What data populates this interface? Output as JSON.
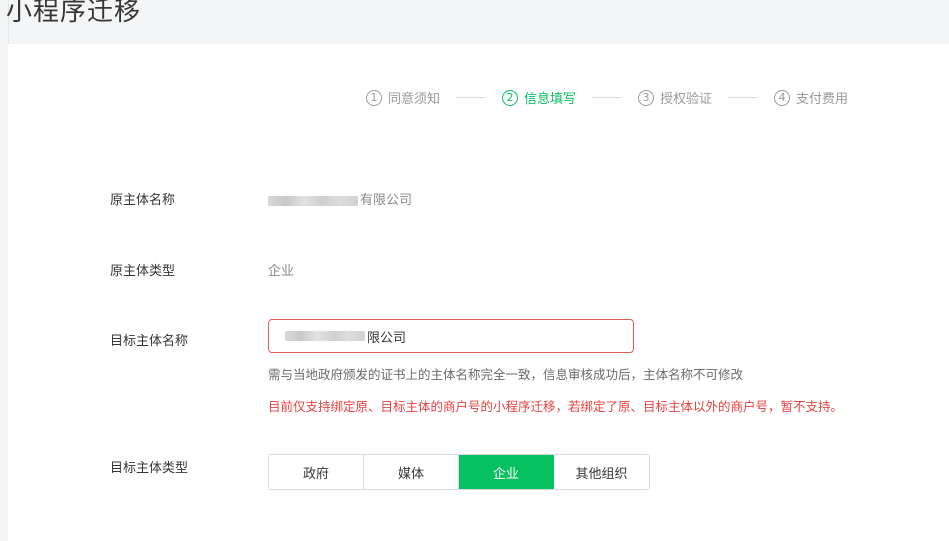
{
  "page": {
    "title": "小程序迁移"
  },
  "stepper": {
    "steps": [
      {
        "num": "1",
        "label": "同意须知"
      },
      {
        "num": "2",
        "label": "信息填写"
      },
      {
        "num": "3",
        "label": "授权验证"
      },
      {
        "num": "4",
        "label": "支付费用"
      }
    ],
    "active_index": 1,
    "accent_color": "#07c160"
  },
  "form": {
    "original_name_label": "原主体名称",
    "original_name_value_visible": "有限公司",
    "original_type_label": "原主体类型",
    "original_type_value": "企业",
    "target_name_label": "目标主体名称",
    "target_name_value_visible": "限公司",
    "target_name_hint": "需与当地政府颁发的证书上的主体名称完全一致，信息审核成功后，主体名称不可修改",
    "target_name_warning": "目前仅支持绑定原、目标主体的商户号的小程序迁移，若绑定了原、目标主体以外的商户号，暂不支持。",
    "target_type_label": "目标主体类型",
    "target_type_options": [
      "政府",
      "媒体",
      "企业",
      "其他组织"
    ],
    "target_type_selected": "企业"
  },
  "colors": {
    "accent": "#07c160",
    "error_border": "#e15f5f",
    "warning_text": "#e64340"
  }
}
